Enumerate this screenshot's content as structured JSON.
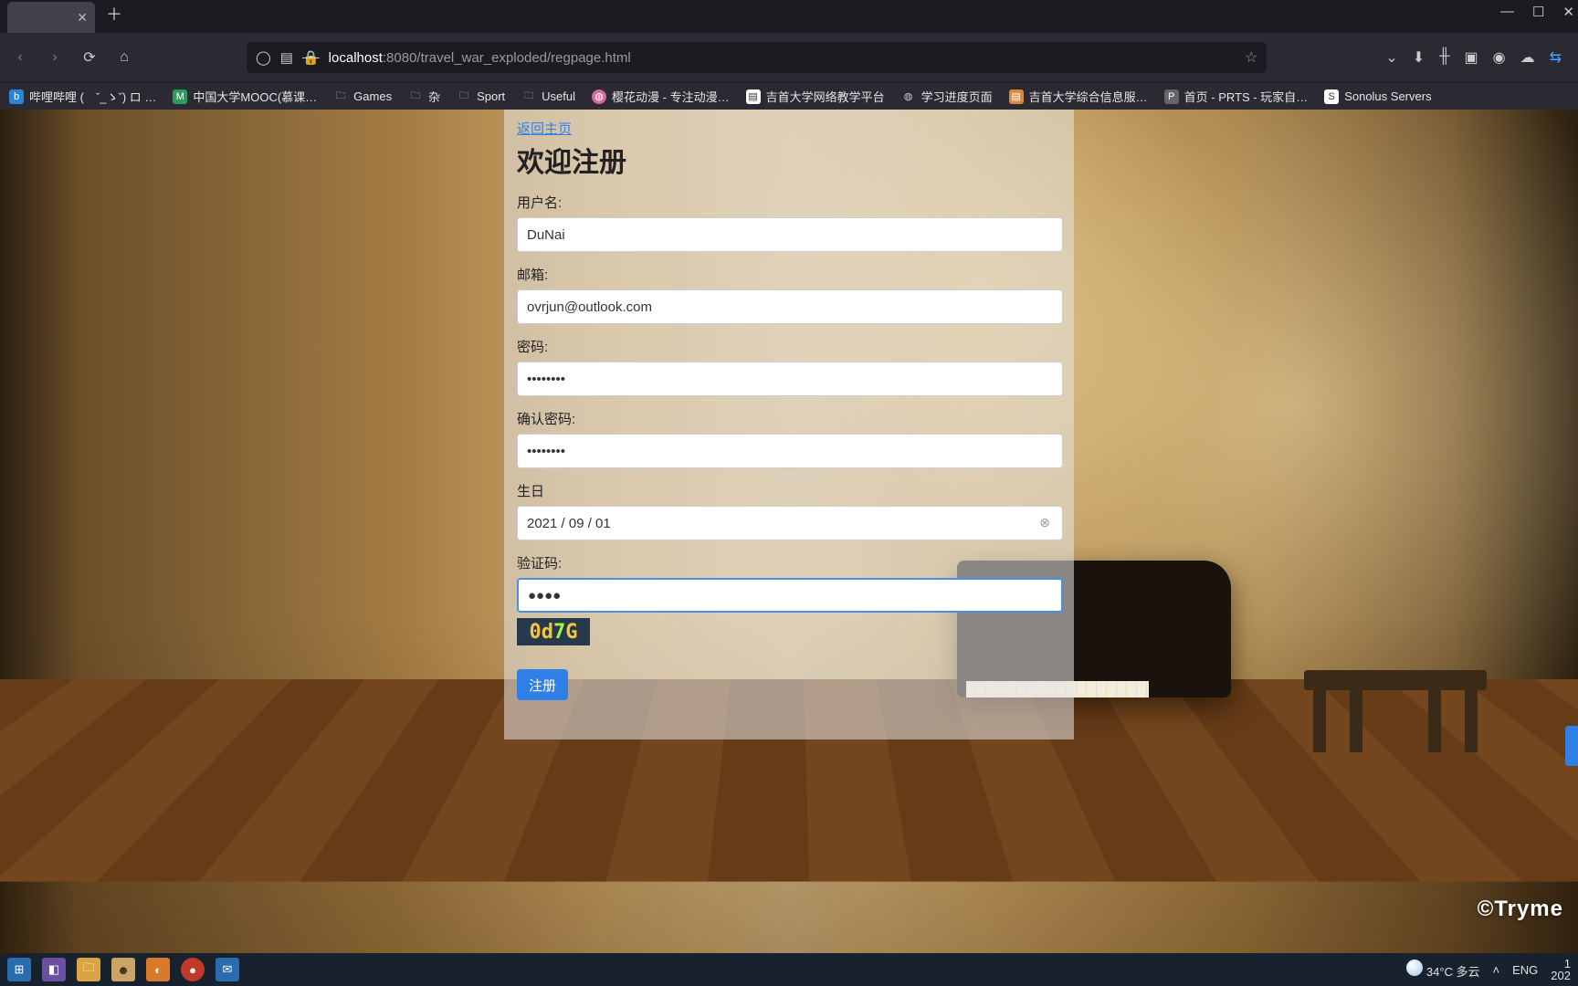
{
  "browser": {
    "tab_title": "",
    "url_host": "localhost",
    "url_port": ":8080",
    "url_path": "/travel_war_exploded/regpage.html"
  },
  "bookmarks": [
    "哔哩哔哩 (　ˇ_ゝˇ) ロ …",
    "中国大学MOOC(慕课…",
    "Games",
    "杂",
    "Sport",
    "Useful",
    "樱花动漫 - 专注动漫…",
    "吉首大学网络教学平台",
    "学习进度页面",
    "吉首大学综合信息服…",
    "首页 - PRTS - 玩家自…",
    "Sonolus Servers"
  ],
  "form": {
    "back_link": "返回主页",
    "title": "欢迎注册",
    "username_label": "用户名:",
    "username_value": "DuNai",
    "email_label": "邮箱:",
    "email_value": "ovrjun@outlook.com",
    "password_label": "密码:",
    "password_value": "••••••••",
    "confirm_label": "确认密码:",
    "confirm_value": "••••••••",
    "birthday_label": "生日",
    "birthday_value": "2021 / 09 / 01",
    "captcha_label": "验证码:",
    "captcha_input_value": "●●●●",
    "captcha_code": "0d7G",
    "submit_label": "注册"
  },
  "page": {
    "watermark": "©Tryme"
  },
  "taskbar": {
    "weather": "34°C 多云",
    "lang": "ENG",
    "time_line1": "1",
    "time_line2": "202"
  },
  "icon_text": {
    "close": "✕",
    "plus": "＋",
    "back": "‹",
    "forward": "›",
    "reload": "⟳",
    "home": "⌂",
    "shield": "◯",
    "lock": "🔒",
    "info": "ⓘ",
    "star": "☆",
    "pocket": "⌄",
    "download": "⬇",
    "library": "╫",
    "reader": "▣",
    "circle": "◉",
    "cloud": "☁",
    "sync": "⇆",
    "min": "—",
    "max": "☐",
    "folder": "🗀",
    "globe": "◍",
    "page": "▤",
    "caret_up": "˄",
    "clear": "⊗"
  }
}
